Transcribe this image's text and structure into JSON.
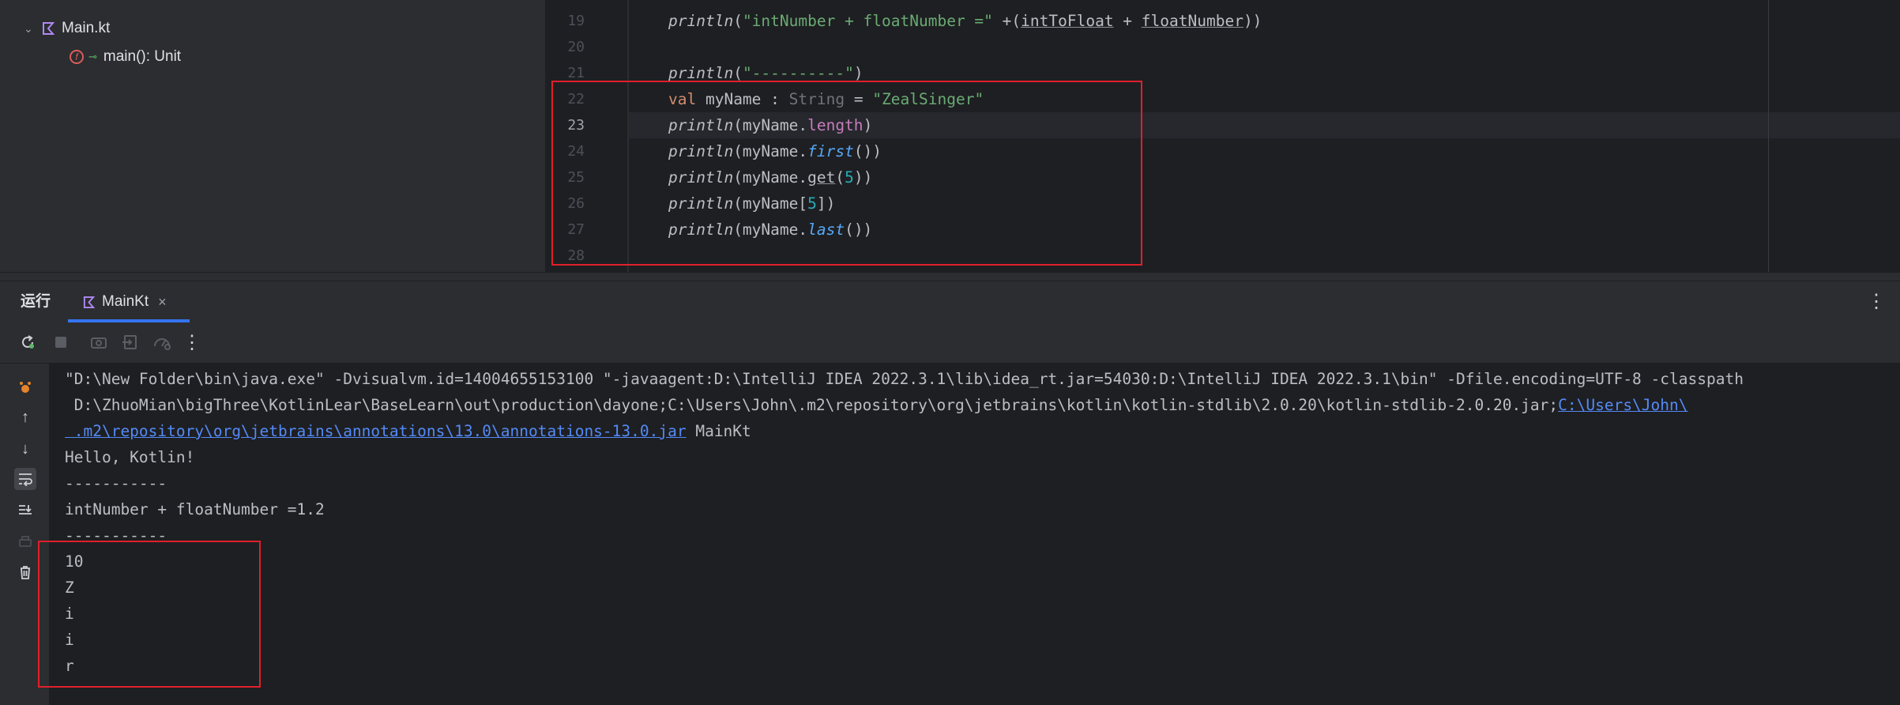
{
  "structure": {
    "file_label": "Main.kt",
    "function_label": "main(): Unit"
  },
  "editor": {
    "lines": [
      {
        "num": "19"
      },
      {
        "num": "20"
      },
      {
        "num": "21"
      },
      {
        "num": "22"
      },
      {
        "num": "23"
      },
      {
        "num": "24"
      },
      {
        "num": "25"
      },
      {
        "num": "26"
      },
      {
        "num": "27"
      },
      {
        "num": "28"
      }
    ],
    "l19": {
      "fn": "println",
      "p1": "(",
      "str": "\"intNumber + floatNumber =\"",
      "p2": " +(",
      "v1": "intToFloat",
      "op": " + ",
      "v2": "floatNumber",
      "p3": "))"
    },
    "l21": {
      "fn": "println",
      "p1": "(",
      "str": "\"----------\"",
      "p2": ")"
    },
    "l22": {
      "kw": "val",
      "name": " myName : ",
      "type": "String",
      "eq": " = ",
      "str": "\"ZealSinger\""
    },
    "l23": {
      "fn": "println",
      "p1": "(myName.",
      "prop": "length",
      "p2": ")"
    },
    "l24": {
      "fn": "println",
      "p1": "(myName.",
      "ext": "first",
      "p2": "())"
    },
    "l25": {
      "fn": "println",
      "p1": "(myName.",
      "m": "get",
      "p2": "(",
      "num": "5",
      "p3": "))"
    },
    "l26": {
      "fn": "println",
      "p1": "(myName[",
      "num": "5",
      "p2": "])"
    },
    "l27": {
      "fn": "println",
      "p1": "(myName.",
      "ext": "last",
      "p2": "())"
    }
  },
  "run": {
    "title": "运行",
    "tab_label": "MainKt",
    "close": "×",
    "more": "⋮"
  },
  "toolbar": {
    "icons": [
      "rerun-icon",
      "stop-icon",
      "screenshot-icon",
      "restore-layout-icon",
      "settings-icon",
      "more-icon"
    ]
  },
  "console": {
    "cmd1": "\"D:\\New Folder\\bin\\java.exe\" -Dvisualvm.id=14004655153100 \"-javaagent:D:\\IntelliJ IDEA 2022.3.1\\lib\\idea_rt.jar=54030:D:\\IntelliJ IDEA 2022.3.1\\bin\" -Dfile.encoding=UTF-8 -classpath",
    "cmd2_text": " D:\\ZhuoMian\\bigThree\\KotlinLear\\BaseLearn\\out\\production\\dayone;C:\\Users\\John\\.m2\\repository\\org\\jetbrains\\kotlin\\kotlin-stdlib\\2.0.20\\kotlin-stdlib-2.0.20.jar;",
    "cmd2_link": "C:\\Users\\John\\",
    "cmd3_link": " .m2\\repository\\org\\jetbrains\\annotations\\13.0\\annotations-13.0.jar",
    "cmd3_text": " MainKt",
    "output": [
      "Hello, Kotlin!",
      "-----------",
      "intNumber + floatNumber =1.2",
      "-----------",
      "10",
      "Z",
      "i",
      "i",
      "r"
    ]
  }
}
